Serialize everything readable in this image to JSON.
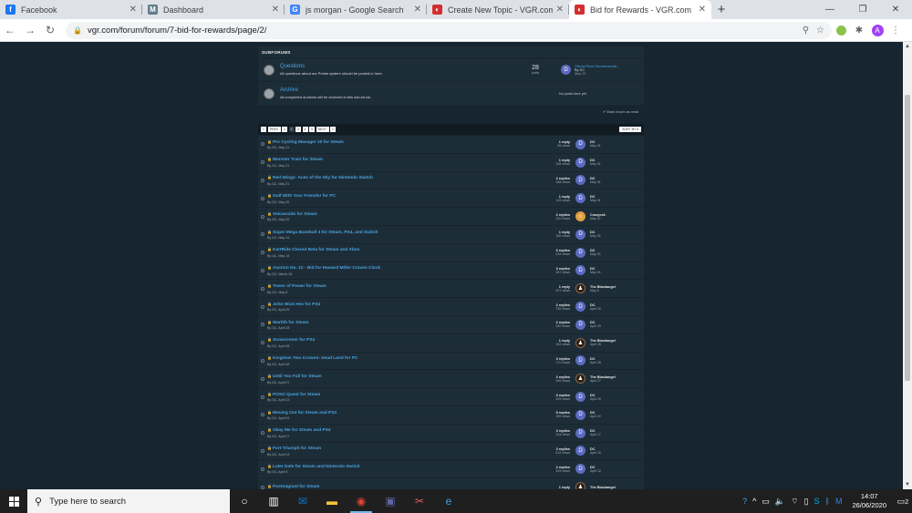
{
  "browser": {
    "tabs": [
      {
        "title": "Facebook",
        "icon": "facebook-icon",
        "color": "#1877f2",
        "glyph": "f"
      },
      {
        "title": "Dashboard",
        "icon": "m-logo-icon",
        "color": "#607d8b",
        "glyph": "M"
      },
      {
        "title": "js morgan - Google Search",
        "icon": "google-icon",
        "color": "#4285f4",
        "glyph": "G"
      },
      {
        "title": "Create New Topic - VGR.com",
        "icon": "vgr-icon",
        "color": "#d32f2f",
        "glyph": "◐"
      },
      {
        "title": "Bid for Rewards - VGR.com",
        "icon": "vgr-icon",
        "color": "#d32f2f",
        "glyph": "◐",
        "active": true
      }
    ],
    "url": "vgr.com/forum/forum/7-bid-for-rewards/page/2/",
    "profile_initial": "A"
  },
  "subforums": {
    "heading": "SUBFORUMS",
    "items": [
      {
        "title": "Questions",
        "desc": "All questions about our Points system should be posted in here.",
        "count": "28",
        "count_label": "posts",
        "last_title": "Official Price Recommenda...",
        "last_by": "By DC",
        "last_date": "May 22",
        "last_avatar": "D"
      },
      {
        "title": "Archive",
        "desc": "All completed auctions will be archived in this sub-forum.",
        "empty": "No posts here yet"
      }
    ],
    "mark_read": "✔ Mark forum as read"
  },
  "pager": {
    "prev": "PREV",
    "pages": [
      "1",
      "2",
      "3",
      "4",
      "5"
    ],
    "next": "NEXT",
    "sort": "SORT BY ▾"
  },
  "topics": [
    {
      "title": "Pro Cycling Manager 20 for Steam",
      "by": "By DC, May 21",
      "replies": "1 reply",
      "views": "96 views",
      "last": "DC",
      "date": "May 24",
      "av": "D",
      "kind": "d"
    },
    {
      "title": "Monster Train for Steam",
      "by": "By DC, May 21",
      "replies": "1 reply",
      "views": "108 views",
      "last": "DC",
      "date": "May 24",
      "av": "D",
      "kind": "d"
    },
    {
      "title": "Red Wings: Aces of the Sky for Nintendo Switch",
      "by": "By DC, May 21",
      "replies": "2 replies",
      "views": "158 views",
      "last": "DC",
      "date": "May 24",
      "av": "D",
      "kind": "d"
    },
    {
      "title": "Golf With Your Friends! for PC",
      "by": "By DC, May 20",
      "replies": "1 reply",
      "views": "115 views",
      "last": "DC",
      "date": "May 24",
      "av": "D",
      "kind": "d"
    },
    {
      "title": "Volcanoids for Steam",
      "by": "By DC, May 20",
      "replies": "2 replies",
      "views": "220 views",
      "last": "Crazycek",
      "date": "May 22",
      "av": "☺",
      "kind": "ok"
    },
    {
      "title": "Super Mega Baseball 3 for Steam, PS4, and Switch",
      "by": "By DC, May 14",
      "replies": "1 reply",
      "views": "150 views",
      "last": "DC",
      "date": "May 18",
      "av": "D",
      "kind": "d"
    },
    {
      "title": "KartRide Closed Beta for Steam and Xbox",
      "by": "By DC, May 14",
      "replies": "6 replies",
      "views": "229 views",
      "last": "DC",
      "date": "May 15",
      "av": "D",
      "kind": "d"
    },
    {
      "title": "Auction No. 12 - Bid for Howard Miller Craven Clock",
      "by": "By DC, March 30",
      "replies": "3 replies",
      "views": "387 views",
      "last": "DC",
      "date": "May 15",
      "av": "D",
      "kind": "d"
    },
    {
      "title": "Tower of Power for Steam",
      "by": "By DC, May 8",
      "replies": "1 reply",
      "views": "207 views",
      "last": "The Blackangel",
      "date": "May 8",
      "av": "♟",
      "kind": "bk"
    },
    {
      "title": "John Wick Hex for PS4",
      "by": "By DC, April 29",
      "replies": "2 replies",
      "views": "730 views",
      "last": "DC",
      "date": "April 30",
      "av": "D",
      "kind": "d"
    },
    {
      "title": "Warlith for Steam",
      "by": "By DC, April 28",
      "replies": "2 replies",
      "views": "150 views",
      "last": "DC",
      "date": "April 29",
      "av": "D",
      "kind": "d"
    },
    {
      "title": "Snowrunner for PS4",
      "by": "By DC, April 28",
      "replies": "1 reply",
      "views": "152 views",
      "last": "The Blackangel",
      "date": "April 28",
      "av": "♟",
      "kind": "bk"
    },
    {
      "title": "Kingdom Two Crowns: Dead Land for PC",
      "by": "By DC, April 28",
      "replies": "3 replies",
      "views": "170 views",
      "last": "DC",
      "date": "April 28",
      "av": "D",
      "kind": "d"
    },
    {
      "title": "Until You Fall for Steam",
      "by": "By DC, April 27",
      "replies": "2 replies",
      "views": "160 views",
      "last": "The Blackangel",
      "date": "April 27",
      "av": "♟",
      "kind": "bk"
    },
    {
      "title": "POSO Quest for Steam",
      "by": "By DC, April 23",
      "replies": "3 replies",
      "views": "229 views",
      "last": "DC",
      "date": "April 25",
      "av": "D",
      "kind": "d"
    },
    {
      "title": "Moving Out for Steam and PS4",
      "by": "By DC, April 22",
      "replies": "5 replies",
      "views": "269 views",
      "last": "DC",
      "date": "April 22",
      "av": "D",
      "kind": "d"
    },
    {
      "title": "Okay Me for Steam and PS4",
      "by": "By DC, April 17",
      "replies": "3 replies",
      "views": "243 views",
      "last": "DC",
      "date": "April 17",
      "av": "D",
      "kind": "d"
    },
    {
      "title": "Fort Triumph for Steam",
      "by": "By DC, April 13",
      "replies": "3 replies",
      "views": "612 views",
      "last": "DC",
      "date": "April 15",
      "av": "D",
      "kind": "d"
    },
    {
      "title": "Later Date for Steam and Nintendo Switch",
      "by": "By DC, April 9",
      "replies": "2 replies",
      "views": "293 views",
      "last": "DC",
      "date": "April 12",
      "av": "D",
      "kind": "d"
    },
    {
      "title": "Postmigrant for Steam",
      "by": "",
      "replies": "1 reply",
      "views": "",
      "last": "The Blackangel",
      "date": "",
      "av": "♟",
      "kind": "bk"
    }
  ],
  "taskbar": {
    "search_placeholder": "Type here to search",
    "time": "14:07",
    "date": "26/06/2020",
    "notifications": "2"
  }
}
